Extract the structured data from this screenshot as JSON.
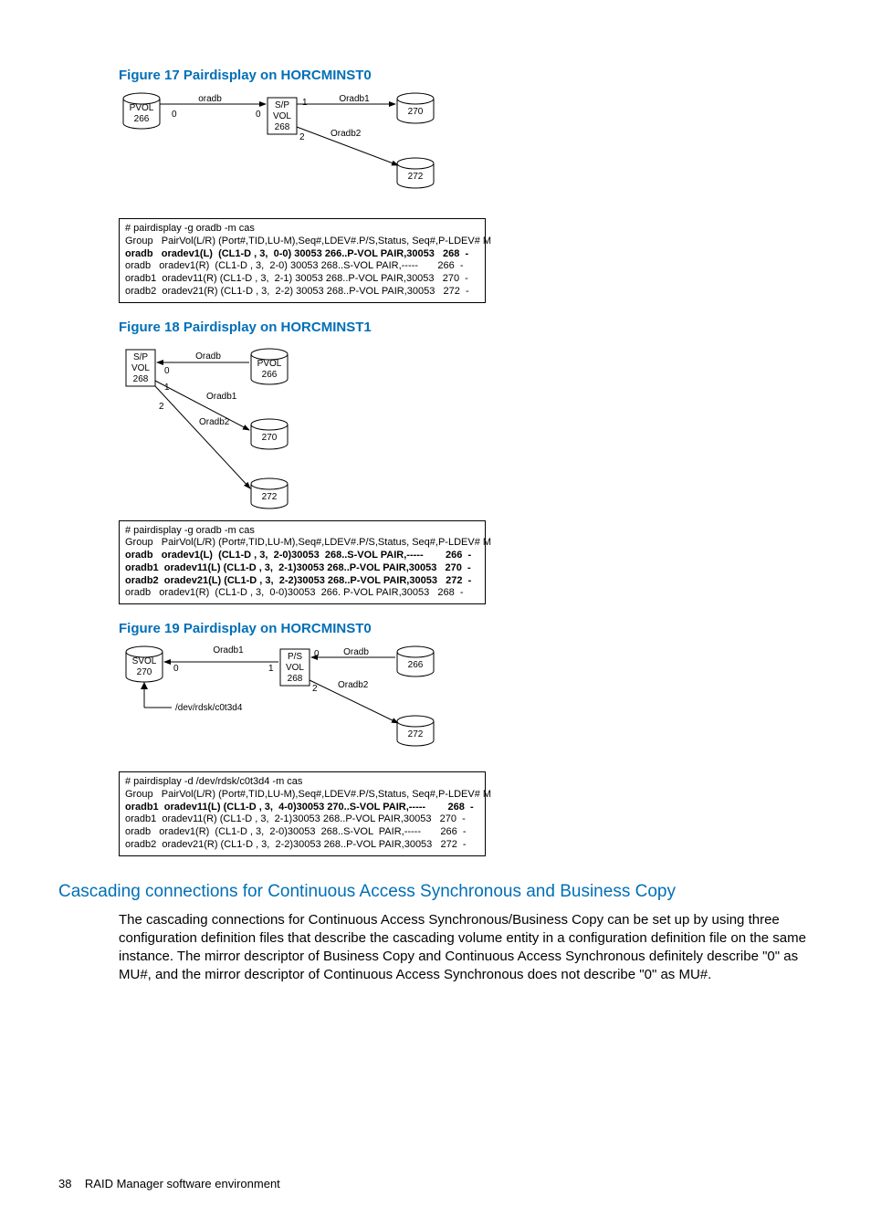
{
  "figures": {
    "f17": {
      "caption": "Figure 17 Pairdisplay on HORCMINST0",
      "lbl_pvol": "PVOL",
      "lbl_266": "266",
      "lbl_sp": "S/P",
      "lbl_vol": "VOL",
      "lbl_268": "268",
      "lbl_270": "270",
      "lbl_272": "272",
      "lbl_oradb": "oradb",
      "lbl_oradb1": "Oradb1",
      "lbl_oradb2": "Oradb2",
      "n0": "0",
      "n1": "1",
      "n2": "2"
    },
    "f18": {
      "caption": "Figure 18 Pairdisplay on HORCMINST1",
      "lbl_sp": "S/P",
      "lbl_vol": "VOL",
      "lbl_268": "268",
      "lbl_pvol": "PVOL",
      "lbl_266": "266",
      "lbl_270": "270",
      "lbl_272": "272",
      "lbl_oradb": "Oradb",
      "lbl_oradb1": "Oradb1",
      "lbl_oradb2": "Oradb2",
      "n0": "0",
      "n1": "1",
      "n2": "2"
    },
    "f19": {
      "caption": "Figure 19 Pairdisplay on HORCMINST0",
      "lbl_svol": "SVOL",
      "lbl_270": "270",
      "lbl_ps": "P/S",
      "lbl_vol": "VOL",
      "lbl_268": "268",
      "lbl_266": "266",
      "lbl_272": "272",
      "lbl_oradb": "Oradb",
      "lbl_oradb1": "Oradb1",
      "lbl_oradb2": "Oradb2",
      "lbl_dev": "/dev/rdsk/c0t3d4",
      "n0": "0",
      "n1": "1",
      "n2": "2"
    }
  },
  "cmd17": {
    "l1": "# pairdisplay -g oradb -m cas",
    "l2": "Group   PairVol(L/R) (Port#,TID,LU-M),Seq#,LDEV#.P/S,Status, Seq#,P-LDEV# M",
    "l3": "oradb   oradev1(L)  (CL1-D , 3,  0-0) 30053 266..P-VOL PAIR,30053   268  -",
    "l4": "oradb   oradev1(R)  (CL1-D , 3,  2-0) 30053 268..S-VOL PAIR,-----       266  -",
    "l5": "oradb1  oradev11(R) (CL1-D , 3,  2-1) 30053 268..P-VOL PAIR,30053   270  -",
    "l6": "oradb2  oradev21(R) (CL1-D , 3,  2-2) 30053 268..P-VOL PAIR,30053   272  -"
  },
  "cmd18": {
    "l1": "# pairdisplay -g oradb -m cas",
    "l2": "Group   PairVol(L/R) (Port#,TID,LU-M),Seq#,LDEV#.P/S,Status, Seq#,P-LDEV# M",
    "l3": "oradb   oradev1(L)  (CL1-D , 3,  2-0)30053  268..S-VOL PAIR,-----        266  -",
    "l4": "oradb1  oradev11(L) (CL1-D , 3,  2-1)30053 268..P-VOL PAIR,30053   270  -",
    "l5": "oradb2  oradev21(L) (CL1-D , 3,  2-2)30053 268..P-VOL PAIR,30053   272  -",
    "l6": "oradb   oradev1(R)  (CL1-D , 3,  0-0)30053  266. P-VOL PAIR,30053   268  -"
  },
  "cmd19": {
    "l1": "# pairdisplay -d /dev/rdsk/c0t3d4 -m cas",
    "l2": "Group   PairVol(L/R) (Port#,TID,LU-M),Seq#,LDEV#.P/S,Status, Seq#,P-LDEV# M",
    "l3": "oradb1  oradev11(L) (CL1-D , 3,  4-0)30053 270..S-VOL PAIR,-----        268  -",
    "l4": "oradb1  oradev11(R) (CL1-D , 3,  2-1)30053 268..P-VOL PAIR,30053   270  -",
    "l5": "oradb   oradev1(R)  (CL1-D , 3,  2-0)30053  268..S-VOL  PAIR,-----       266  -",
    "l6": "oradb2  oradev21(R) (CL1-D , 3,  2-2)30053 268..P-VOL PAIR,30053   272  -"
  },
  "section": {
    "title": "Cascading connections for Continuous Access Synchronous and Business Copy",
    "para": "The cascading connections for Continuous Access Synchronous/Business Copy can be set up by using three configuration definition files that describe the cascading volume entity in a configuration definition file on the same instance. The mirror descriptor of Business Copy and Continuous Access Synchronous definitely describe \"0\" as MU#, and the mirror descriptor of Continuous Access Synchronous does not describe \"0\" as MU#."
  },
  "footer": {
    "page": "38",
    "chapter": "RAID Manager software environment"
  }
}
